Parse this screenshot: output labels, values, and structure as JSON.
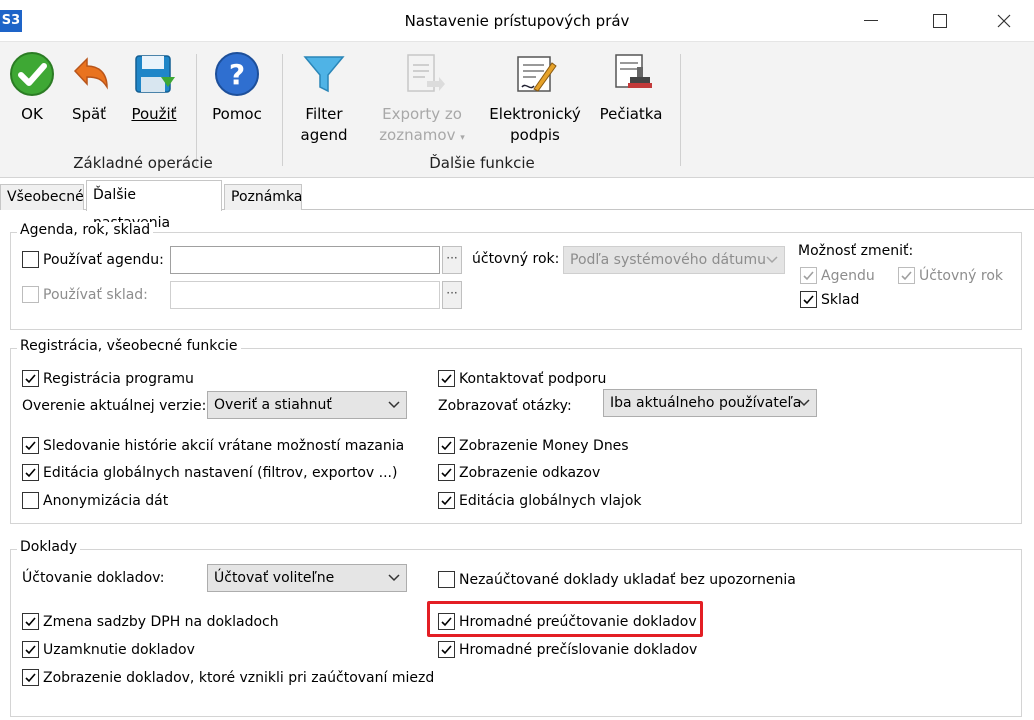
{
  "window": {
    "app_badge": "S3",
    "title": "Nastavenie prístupových práv"
  },
  "ribbon": {
    "ok": "OK",
    "back": "Späť",
    "apply": "Použiť",
    "help": "Pomoc",
    "filter_line1": "Filter",
    "filter_line2": "agend",
    "exports_line1": "Exporty zo",
    "exports_line2": "zoznamov",
    "esign_line1": "Elektronický",
    "esign_line2": "podpis",
    "stamp": "Pečiatka",
    "group_basic": "Základné operácie",
    "group_more": "Ďalšie funkcie"
  },
  "tabs": [
    "Všeobecné",
    "Ďalšie nastavenia",
    "Poznámka"
  ],
  "agenda_group": {
    "title": "Agenda, rok, sklad",
    "use_agenda": "Používať agendu:",
    "use_store": "Používať sklad:",
    "fiscal_year_label": "účtovný rok:",
    "fiscal_year_value": "Podľa systémového dátumu",
    "can_change": "Možnosť zmeniť:",
    "change_agenda": "Agendu",
    "change_year": "Účtovný rok",
    "change_store": "Sklad"
  },
  "registration_group": {
    "title": "Registrácia, všeobecné funkcie",
    "registration": "Registrácia programu",
    "version_check_label": "Overenie aktuálnej verzie:",
    "version_check_value": "Overiť a stiahnuť",
    "history": "Sledovanie histórie akcií vrátane možností mazania",
    "global_settings": "Editácia globálnych nastavení (filtrov, exportov ...)",
    "anonymization": "Anonymizácia dát",
    "contact_support": "Kontaktovať podporu",
    "questions_label": "Zobrazovať otázky:",
    "questions_value": "Iba aktuálneho používateľa",
    "money_today": "Zobrazenie Money Dnes",
    "links": "Zobrazenie odkazov",
    "global_flags": "Editácia globálnych vlajok"
  },
  "documents_group": {
    "title": "Doklady",
    "accounting_label": "Účtovanie dokladov:",
    "accounting_value": "Účtovať voliteľne",
    "vat_change": "Zmena sadzby DPH na dokladoch",
    "lock_docs": "Uzamknutie dokladov",
    "payroll_docs": "Zobrazenie dokladov, ktoré vznikli pri zaúčtovaní miezd",
    "unaccounted_save": "Nezaúčtované doklady ukladať bez upozornenia",
    "bulk_reaccount": "Hromadné preúčtovanie dokladov",
    "bulk_renumber": "Hromadné prečíslovanie dokladov"
  },
  "colors": {
    "accent_blue": "#1e64c8",
    "highlight_red": "#e31e24"
  }
}
